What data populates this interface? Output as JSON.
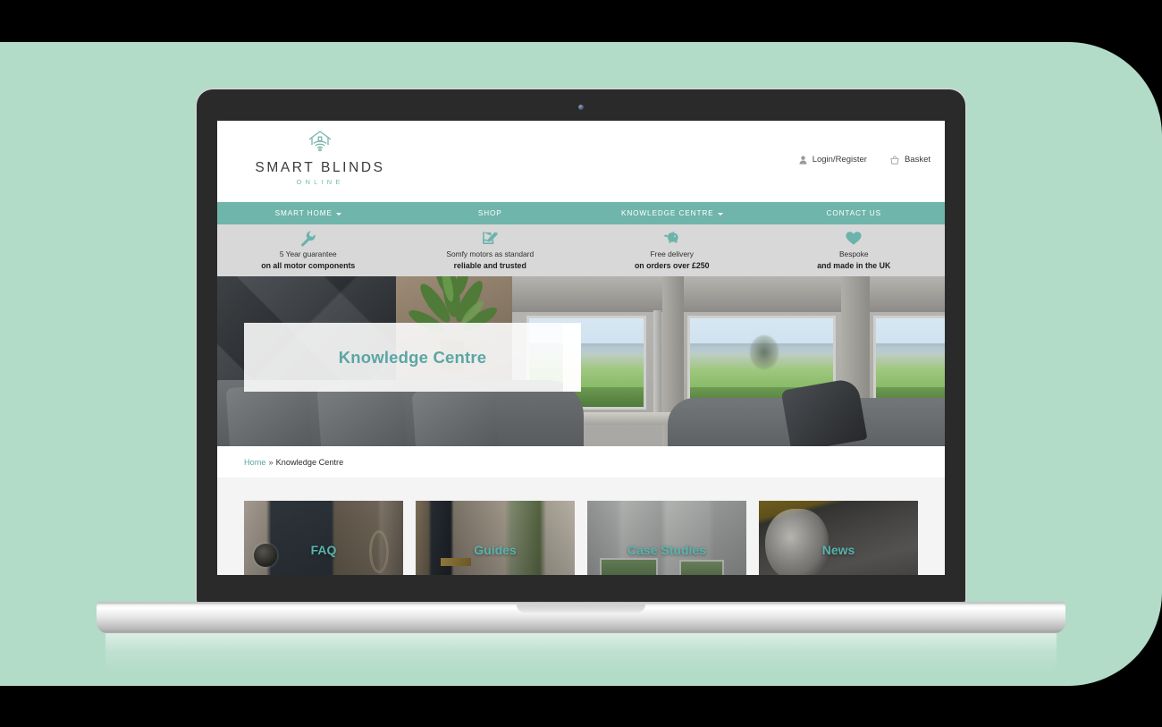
{
  "device": {
    "type": "laptop-mockup",
    "backdrop_color": "#b2dbc8",
    "bezel_color": "#2b2a2b"
  },
  "site": {
    "accent_teal": "#6fb5ab",
    "heading_teal": "#5aa6a4",
    "logo": {
      "name": "SMART BLINDS",
      "subtitle": "ONLINE",
      "icon": "smart-home-wifi-house-icon"
    },
    "account": [
      {
        "label": "Login/Register",
        "icon": "user-icon"
      },
      {
        "label": "Basket",
        "icon": "basket-icon"
      }
    ],
    "nav": [
      {
        "label": "SMART HOME",
        "has_dropdown": true
      },
      {
        "label": "SHOP",
        "has_dropdown": false
      },
      {
        "label": "KNOWLEDGE CENTRE",
        "has_dropdown": true
      },
      {
        "label": "CONTACT US",
        "has_dropdown": false
      }
    ],
    "usps": [
      {
        "icon": "wrench-icon",
        "line1": "5 Year guarantee",
        "line2": "on all motor components"
      },
      {
        "icon": "signature-icon",
        "line1": "Somfy motors as standard",
        "line2": "reliable and trusted"
      },
      {
        "icon": "piggy-bank-icon",
        "line1": "Free delivery",
        "line2": "on orders over £250"
      },
      {
        "icon": "heart-icon",
        "line1": "Bespoke",
        "line2": "and made in the UK"
      }
    ],
    "hero": {
      "title": "Knowledge Centre",
      "image_alt": "Living room with roller blinds and countryside view"
    },
    "breadcrumb": {
      "home": "Home",
      "separator": "»",
      "current": "Knowledge Centre"
    },
    "cards": [
      {
        "label": "FAQ"
      },
      {
        "label": "Guides"
      },
      {
        "label": "Case Studies"
      },
      {
        "label": "News"
      }
    ]
  }
}
